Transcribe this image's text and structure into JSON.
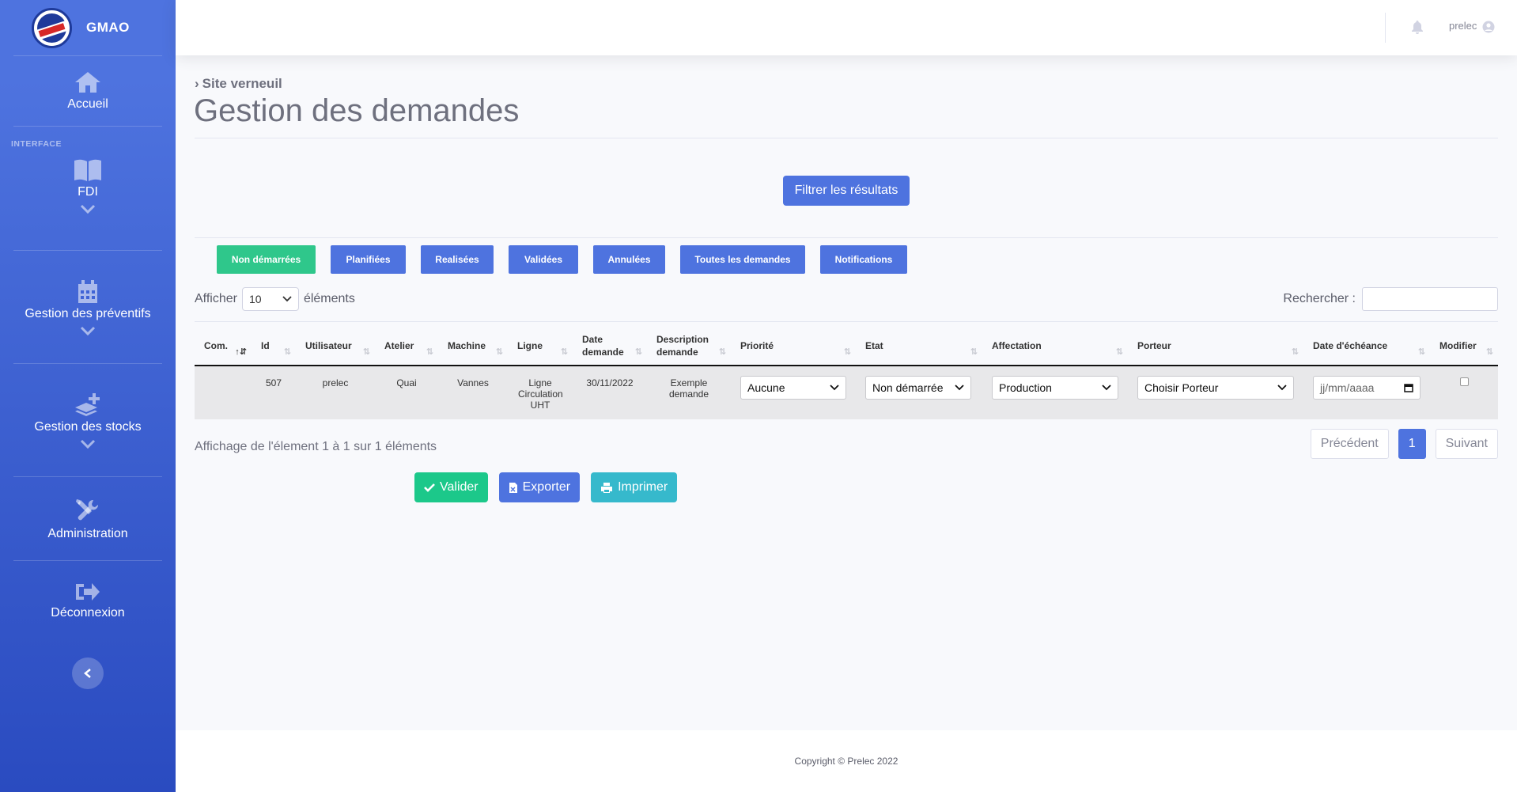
{
  "brand": {
    "name": "GMAO",
    "logo_text": "LAITERIE VERNEUIL"
  },
  "sidebar": {
    "home_label": "Accueil",
    "heading": "INTERFACE",
    "items": [
      {
        "label": "FDI",
        "icon": "book-icon"
      },
      {
        "label": "Gestion des préventifs",
        "icon": "calendar-icon"
      },
      {
        "label": "Gestion des stocks",
        "icon": "layer-plus-icon"
      },
      {
        "label": "Administration",
        "icon": "tools-icon"
      },
      {
        "label": "Déconnexion",
        "icon": "sign-out-icon"
      }
    ]
  },
  "topbar": {
    "username": "prelec"
  },
  "breadcrumb": "Site verneuil",
  "page_title": "Gestion des demandes",
  "filter_button": "Filtrer les résultats",
  "tabs": [
    "Non démarrées",
    "Planifiées",
    "Realisées",
    "Validées",
    "Annulées",
    "Toutes les demandes",
    "Notifications"
  ],
  "length": {
    "prefix": "Afficher",
    "value": "10",
    "suffix": "éléments"
  },
  "search": {
    "label": "Rechercher :",
    "value": ""
  },
  "table": {
    "columns": [
      "Com.",
      "Id",
      "Utilisateur",
      "Atelier",
      "Machine",
      "Ligne",
      "Date demande",
      "Description demande",
      "Priorité",
      "Etat",
      "Affectation",
      "Porteur",
      "Date d'échéance",
      "Modifier"
    ],
    "rows": [
      {
        "com": "",
        "id": "507",
        "user": "prelec",
        "atelier": "Quai",
        "machine": "Vannes",
        "ligne": "Ligne Circulation UHT",
        "date": "30/11/2022",
        "description": "Exemple demande",
        "priorite": "Aucune",
        "etat": "Non démarrée",
        "affectation": "Production",
        "porteur": "Choisir Porteur",
        "echeance_placeholder": "jj/mm/aaaa",
        "modifier": false
      }
    ]
  },
  "info": "Affichage de l'élement 1 à 1 sur 1 éléments",
  "pager": {
    "prev": "Précédent",
    "current": "1",
    "next": "Suivant"
  },
  "actions": {
    "validate": "Valider",
    "export": "Exporter",
    "print": "Imprimer"
  },
  "footer": "Copyright © Prelec 2022",
  "colors": {
    "primary": "#4e73df",
    "success": "#1cc88a",
    "info": "#36b9cc",
    "active_tab": "#2fc78b"
  }
}
